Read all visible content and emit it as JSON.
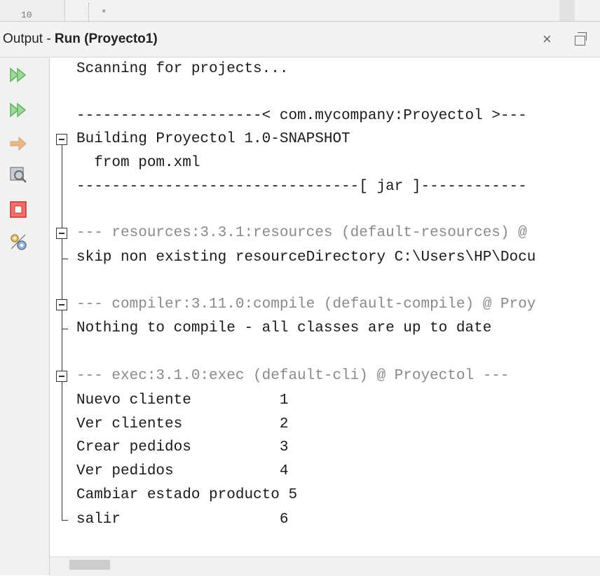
{
  "editor": {
    "line_number": "10",
    "comment_char": "*"
  },
  "titlebar": {
    "prefix": "Output - ",
    "title_bold": "Run (Proyecto1)",
    "close_glyph": "×"
  },
  "toolbar": {
    "buttons": [
      {
        "name": "rerun-icon",
        "color": "#5fb35f"
      },
      {
        "name": "rerun-with-goals-icon",
        "color": "#5fb35f"
      },
      {
        "name": "resume-icon",
        "color": "#d9a066"
      },
      {
        "name": "debug-icon",
        "color": "#8c8c8c"
      },
      {
        "name": "stop-icon",
        "color": "#e04040"
      },
      {
        "name": "settings-icon",
        "color": "#b08a3a"
      }
    ]
  },
  "output": {
    "lines": [
      "Scanning for projects...",
      "",
      "---------------------< com.mycompany:Proyectol >---",
      "Building Proyectol 1.0-SNAPSHOT",
      "  from pom.xml",
      "--------------------------------[ jar ]------------",
      "",
      "--- resources:3.3.1:resources (default-resources) @",
      "skip non existing resourceDirectory C:\\Users\\HP\\Docu",
      "",
      "--- compiler:3.11.0:compile (default-compile) @ Proy",
      "Nothing to compile - all classes are up to date",
      "",
      "--- exec:3.1.0:exec (default-cli) @ Proyectol ---",
      "Nuevo cliente          1",
      "Ver clientes           2",
      "Crear pedidos          3",
      "Ver pedidos            4",
      "Cambiar estado producto 5",
      "salir                  6"
    ]
  }
}
